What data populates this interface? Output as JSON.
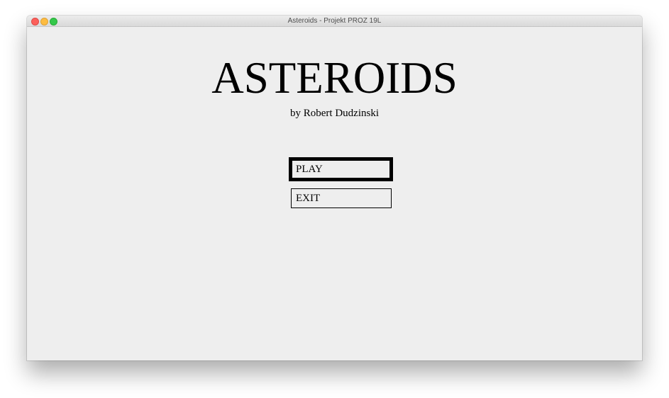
{
  "window": {
    "title": "Asteroids - Projekt PROZ 19L"
  },
  "menu": {
    "game_title": "ASTEROIDS",
    "author": "by Robert Dudzinski",
    "play_label": "PLAY",
    "exit_label": "EXIT",
    "selected": "PLAY"
  }
}
